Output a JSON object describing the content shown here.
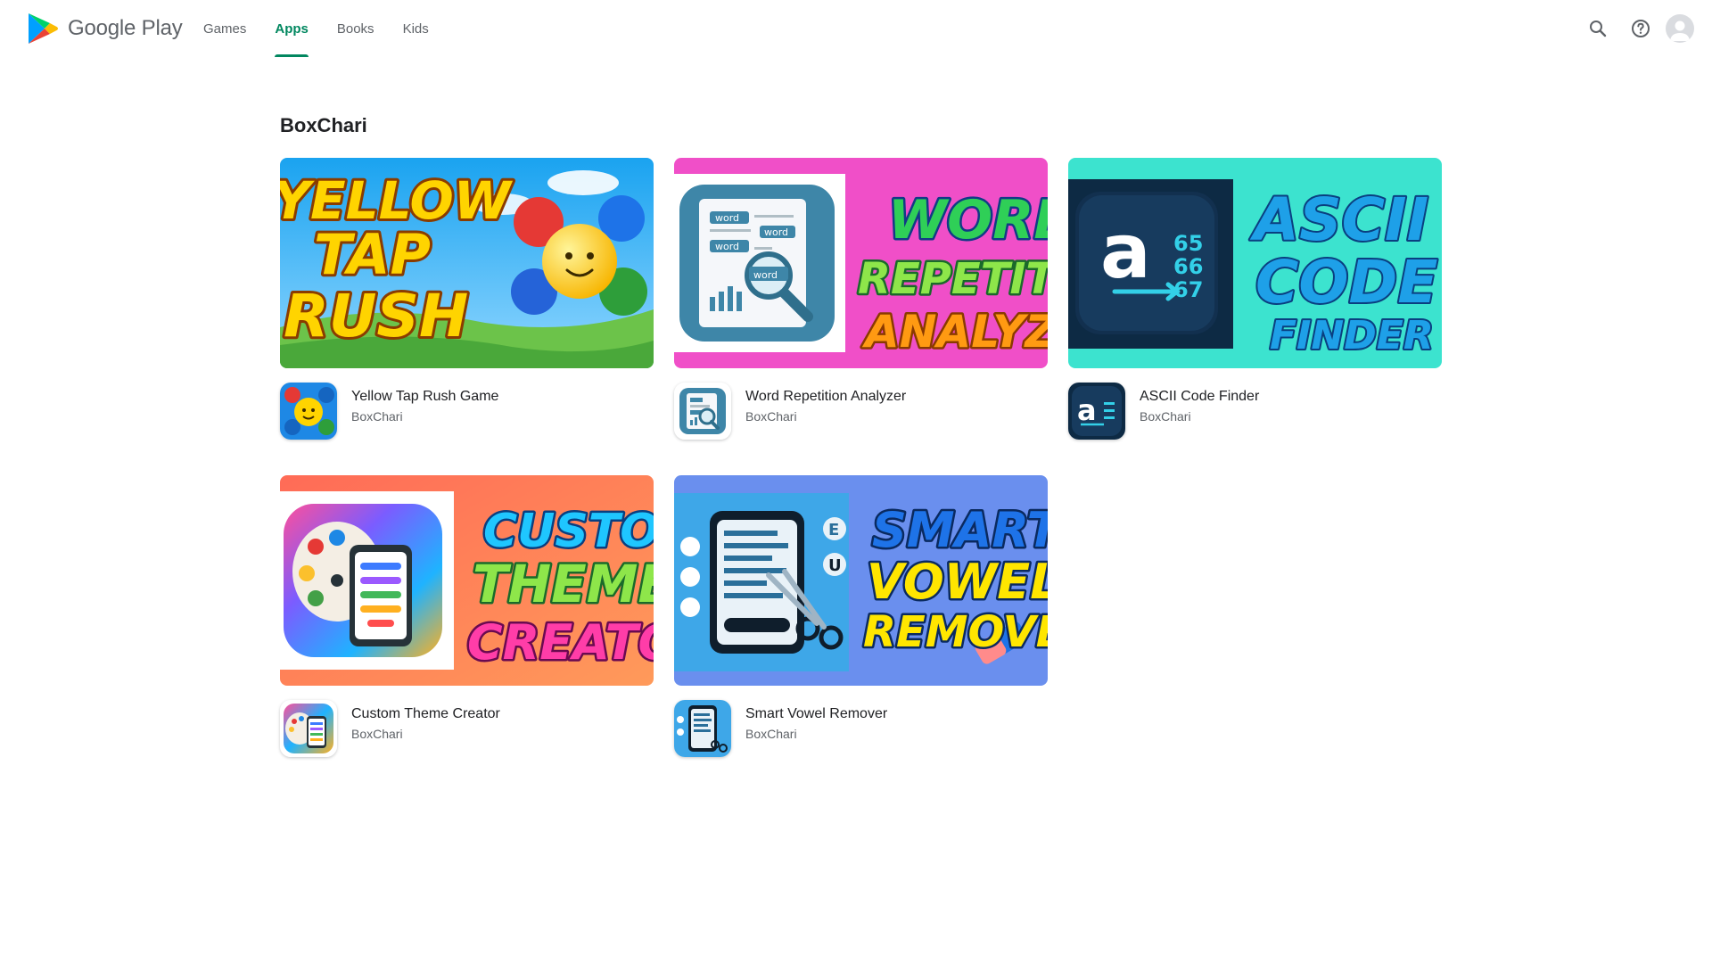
{
  "header": {
    "logo_text": "Google Play",
    "tabs": [
      {
        "label": "Games",
        "active": false
      },
      {
        "label": "Apps",
        "active": true
      },
      {
        "label": "Books",
        "active": false
      },
      {
        "label": "Kids",
        "active": false
      }
    ],
    "icons": [
      "search-icon",
      "help-icon",
      "account-avatar-icon"
    ]
  },
  "colors": {
    "accent": "#01875f",
    "text_primary": "#202124",
    "text_secondary": "#5f6368"
  },
  "page": {
    "title": "BoxChari"
  },
  "apps": [
    {
      "title": "Yellow Tap Rush Game",
      "developer": "BoxChari",
      "banner_lines": [
        "YELLOW",
        "TAP",
        "RUSH"
      ]
    },
    {
      "title": "Word Repetition Analyzer",
      "developer": "BoxChari",
      "banner_lines": [
        "WORD",
        "REPETITION",
        "ANALYZER"
      ],
      "banner_doc_words": [
        "word",
        "word",
        "word",
        "word"
      ]
    },
    {
      "title": "ASCII Code Finder",
      "developer": "BoxChari",
      "banner_lines": [
        "ASCII",
        "CODE",
        "FINDER"
      ],
      "banner_icon_letter": "a",
      "banner_icon_codes": [
        "65",
        "66",
        "67"
      ]
    },
    {
      "title": "Custom Theme Creator",
      "developer": "BoxChari",
      "banner_lines": [
        "CUSTOM",
        "THEME",
        "CREATOR"
      ]
    },
    {
      "title": "Smart Vowel Remover",
      "developer": "BoxChari",
      "banner_lines": [
        "SMART",
        "VOWEL",
        "REMOVER"
      ],
      "banner_side_letters": [
        "E",
        "U"
      ]
    }
  ]
}
